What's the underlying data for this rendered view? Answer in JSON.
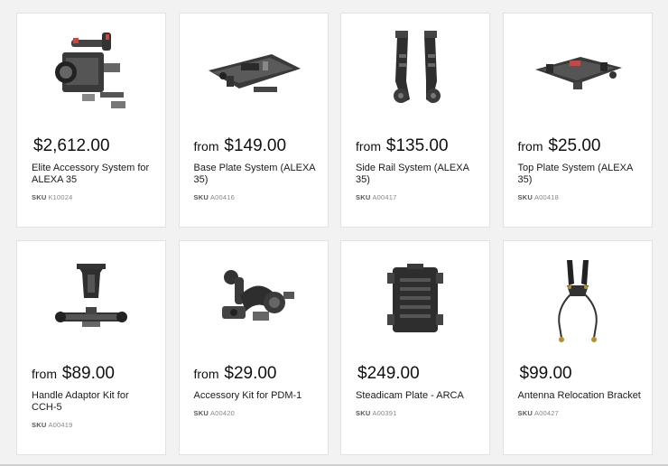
{
  "products": [
    {
      "from": "",
      "price": "$2,612.00",
      "title": "Elite Accessory System for ALEXA 35",
      "sku_label": "SKU",
      "sku": "K10024",
      "image": "camera-rig-image"
    },
    {
      "from": "from",
      "price": "$149.00",
      "title": "Base Plate System (ALEXA 35)",
      "sku_label": "SKU",
      "sku": "A00416",
      "image": "base-plate-image"
    },
    {
      "from": "from",
      "price": "$135.00",
      "title": "Side Rail System (ALEXA 35)",
      "sku_label": "SKU",
      "sku": "A00417",
      "image": "side-rails-image"
    },
    {
      "from": "from",
      "price": "$25.00",
      "title": "Top Plate System (ALEXA 35)",
      "sku_label": "SKU",
      "sku": "A00418",
      "image": "top-plate-image"
    },
    {
      "from": "from",
      "price": "$89.00",
      "title": "Handle Adaptor Kit for CCH-5",
      "sku_label": "SKU",
      "sku": "A00419",
      "image": "handle-adaptor-image"
    },
    {
      "from": "from",
      "price": "$29.00",
      "title": "Accessory Kit for PDM-1",
      "sku_label": "SKU",
      "sku": "A00420",
      "image": "accessory-kit-image"
    },
    {
      "from": "",
      "price": "$249.00",
      "title": "Steadicam Plate - ARCA",
      "sku_label": "SKU",
      "sku": "A00391",
      "image": "steadicam-plate-image"
    },
    {
      "from": "",
      "price": "$99.00",
      "title": "Antenna Relocation Bracket",
      "sku_label": "SKU",
      "sku": "A00427",
      "image": "antenna-bracket-image"
    }
  ]
}
